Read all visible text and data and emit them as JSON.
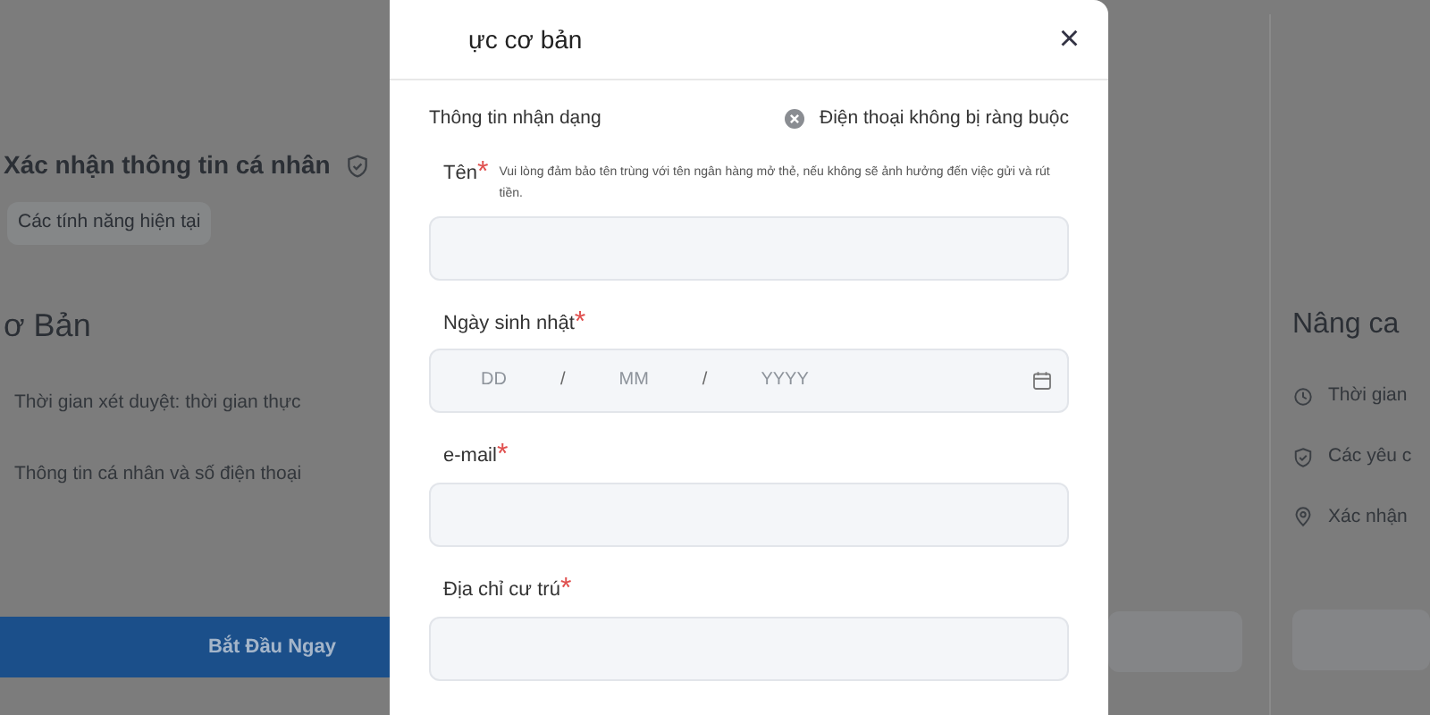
{
  "background": {
    "left_panel": {
      "title": "Xác nhận thông tin cá nhân",
      "chip": "Các tính năng hiện tại",
      "plan_title": "ơ Bản",
      "features": [
        "Thời gian xét duyệt: thời gian thực",
        "Thông tin cá nhân và số điện thoại"
      ],
      "button": "Bắt Đầu Ngay"
    },
    "right_panel": {
      "plan_title": "Nâng ca",
      "features": [
        {
          "kind": "clock",
          "text": "Thời gian"
        },
        {
          "kind": "shield",
          "text": "Các yêu c"
        },
        {
          "kind": "pin",
          "text": "Xác nhận"
        }
      ]
    }
  },
  "modal": {
    "title": "ực cơ bản",
    "close": "×",
    "section_label": "Thông tin nhận dạng",
    "phone_status": "Điện thoại không bị ràng buộc",
    "fields": [
      {
        "kind": "text",
        "label": "Tên",
        "mark": "*",
        "hint": "Vui lòng đảm bảo tên trùng với tên ngân hàng mở thẻ, nếu không sẽ ảnh hưởng đến việc gửi và rút tiền."
      },
      {
        "kind": "date",
        "label": "Ngày sinh nhật",
        "mark": "*",
        "parts": [
          "DD",
          "MM",
          "YYYY"
        ],
        "separators": [
          "/",
          "/"
        ]
      },
      {
        "kind": "text",
        "label": "e-mail",
        "mark": "*"
      },
      {
        "kind": "text",
        "label": "Địa chỉ cư trú",
        "mark": "*"
      }
    ]
  }
}
